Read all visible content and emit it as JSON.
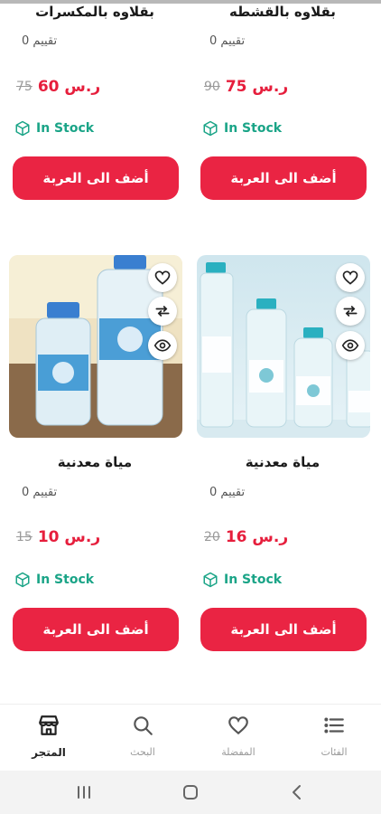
{
  "products": [
    {
      "name": "بقلاوه بالقشطه",
      "rating": "تقييم 0",
      "price": "ر.س 75",
      "old_price": "90",
      "stock": "In Stock",
      "add_label": "أضف الى العربة"
    },
    {
      "name": "بقلاوه بالمكسرات",
      "rating": "تقييم 0",
      "price": "ر.س 60",
      "old_price": "75",
      "stock": "In Stock",
      "add_label": "أضف الى العربة"
    },
    {
      "name": "مياة معدنية",
      "rating": "تقييم 0",
      "price": "ر.س 16",
      "old_price": "20",
      "stock": "In Stock",
      "add_label": "أضف الى العربة",
      "image_icon": "water-bottles-image",
      "actions": [
        "heart-icon",
        "compare-icon",
        "eye-icon"
      ]
    },
    {
      "name": "مياة معدنية",
      "rating": "تقييم 0",
      "price": "ر.س 10",
      "old_price": "15",
      "stock": "In Stock",
      "add_label": "أضف الى العربة",
      "image_icon": "water-bottles-image",
      "actions": [
        "heart-icon",
        "compare-icon",
        "eye-icon"
      ]
    }
  ],
  "bottom_nav": {
    "items": [
      {
        "label": "الفئات",
        "icon": "list-icon"
      },
      {
        "label": "المفضلة",
        "icon": "heart-icon"
      },
      {
        "label": "البحث",
        "icon": "search-icon"
      },
      {
        "label": "المتجر",
        "icon": "store-icon",
        "active": true
      }
    ]
  },
  "colors": {
    "accent": "#ea2443",
    "price": "#e61e3c",
    "stock": "#1aa487"
  }
}
